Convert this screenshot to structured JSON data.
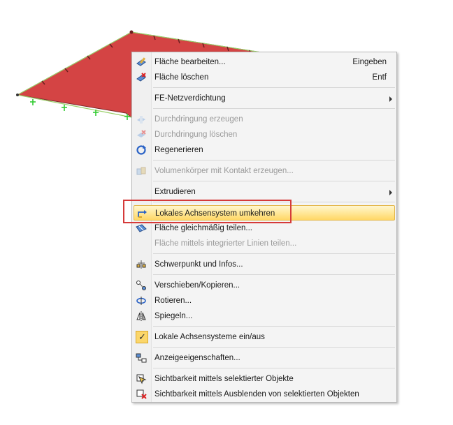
{
  "menu": {
    "items": [
      {
        "label": "Fläche bearbeiten...",
        "shortcut": "Eingeben",
        "icon": "edit-surface-icon",
        "disabled": false
      },
      {
        "label": "Fläche löschen",
        "shortcut": "Entf",
        "icon": "delete-surface-icon",
        "disabled": false
      },
      {
        "label": "FE-Netzverdichtung",
        "icon": "",
        "disabled": false,
        "submenu": true
      },
      {
        "label": "Durchdringung erzeugen",
        "icon": "create-intersection-icon",
        "disabled": true
      },
      {
        "label": "Durchdringung löschen",
        "icon": "delete-intersection-icon",
        "disabled": true
      },
      {
        "label": "Regenerieren",
        "icon": "regenerate-icon",
        "disabled": false
      },
      {
        "label": "Volumenkörper mit Kontakt erzeugen...",
        "icon": "contact-solid-icon",
        "disabled": true
      },
      {
        "label": "Extrudieren",
        "icon": "",
        "disabled": false,
        "submenu": true
      },
      {
        "label": "Lokales Achsensystem umkehren",
        "icon": "reverse-axis-icon",
        "disabled": false,
        "highlighted": true
      },
      {
        "label": "Fläche gleichmäßig teilen...",
        "icon": "divide-surface-icon",
        "disabled": false
      },
      {
        "label": "Fläche mittels integrierter Linien teilen...",
        "icon": "",
        "disabled": true
      },
      {
        "label": "Schwerpunkt und Infos...",
        "icon": "centroid-icon",
        "disabled": false
      },
      {
        "label": "Verschieben/Kopieren...",
        "icon": "move-copy-icon",
        "disabled": false
      },
      {
        "label": "Rotieren...",
        "icon": "rotate-icon",
        "disabled": false
      },
      {
        "label": "Spiegeln...",
        "icon": "mirror-icon",
        "disabled": false
      },
      {
        "label": "Lokale Achsensysteme ein/aus",
        "icon": "checkmark-icon",
        "disabled": false,
        "checked": true
      },
      {
        "label": "Anzeigeeigenschaften...",
        "icon": "display-properties-icon",
        "disabled": false
      },
      {
        "label": "Sichtbarkeit mittels selektierter Objekte",
        "icon": "visibility-selected-icon",
        "disabled": false
      },
      {
        "label": "Sichtbarkeit mittels Ausblenden von selektierten Objekten",
        "icon": "visibility-hide-icon",
        "disabled": false
      }
    ]
  },
  "colors": {
    "surface_fill": "#d44444",
    "surface_edge": "#6b2020",
    "support_green": "#33cc33",
    "highlight_border": "#d53a3a"
  }
}
